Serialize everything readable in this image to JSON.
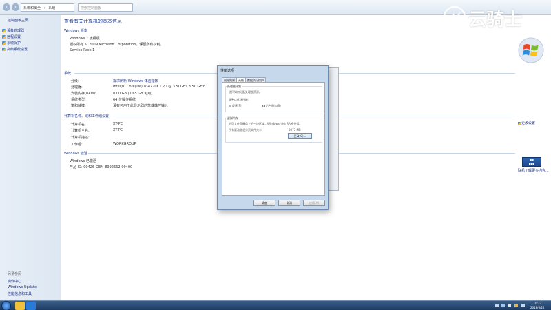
{
  "address_bar": {
    "crumbs": [
      "系统和安全",
      "系统"
    ],
    "search_placeholder": "搜索控制面板"
  },
  "left_nav": {
    "home": "控制面板主页",
    "items": [
      "设备管理器",
      "远程设置",
      "系统保护",
      "高级系统设置"
    ],
    "see_also_title": "另请参阅",
    "see_also": [
      "操作中心",
      "Windows Update",
      "性能信息和工具"
    ]
  },
  "main": {
    "title": "查看有关计算机的基本信息",
    "edition": {
      "heading": "Windows 版本",
      "name": "Windows 7 旗舰版",
      "copyright": "版权所有 © 2009 Microsoft Corporation。保留所有权利。",
      "service_pack": "Service Pack 1"
    },
    "system": {
      "heading": "系统",
      "rows": [
        {
          "label": "分级:",
          "value": "需求刷新 Windows 体验指数"
        },
        {
          "label": "处理器:",
          "value": "Intel(R) Core(TM) i7-4770K CPU @ 3.50GHz   3.50 GHz"
        },
        {
          "label": "安装内存(RAM):",
          "value": "8.00 GB (7.65 GB 可用)"
        },
        {
          "label": "系统类型:",
          "value": "64 位操作系统"
        },
        {
          "label": "笔和触摸:",
          "value": "没有可用于此显示器的笔或触控输入"
        }
      ]
    },
    "computer": {
      "heading": "计算机名称、域和工作组设置",
      "rows": [
        {
          "label": "计算机名:",
          "value": "XT-PC"
        },
        {
          "label": "计算机全名:",
          "value": "XT-PC"
        },
        {
          "label": "计算机描述:",
          "value": ""
        },
        {
          "label": "工作组:",
          "value": "WORKGROUP"
        }
      ],
      "change_settings": "更改设置"
    },
    "activation": {
      "heading": "Windows 激活",
      "status": "Windows 已激活",
      "product_id": "产品 ID: 00426-OEM-8992662-00400",
      "more": "联机了解更多内容..."
    }
  },
  "dialog": {
    "title": "性能选项",
    "tabs": [
      "视觉效果",
      "高级",
      "数据执行保护"
    ],
    "active_tab": 1,
    "scheduling": {
      "heading": "处理器计划",
      "desc": "选择如何分配处理器资源。",
      "adjust": "调整以优化性能:",
      "opt_programs": "程序(P)",
      "opt_services": "后台服务(S)"
    },
    "virtual_memory": {
      "heading": "虚拟内存",
      "desc": "分页文件是硬盘上的一块区域，Windows 当作 RAM 使用。",
      "total_label": "所有驱动器总分页文件大小:",
      "total_value": "8073 MB",
      "change_button": "更改(C)..."
    },
    "buttons": {
      "ok": "确定",
      "cancel": "取消",
      "apply": "应用(A)"
    }
  },
  "watermark": "云骑士",
  "taskbar": {
    "time": "10:32",
    "date": "2018/6/22"
  }
}
